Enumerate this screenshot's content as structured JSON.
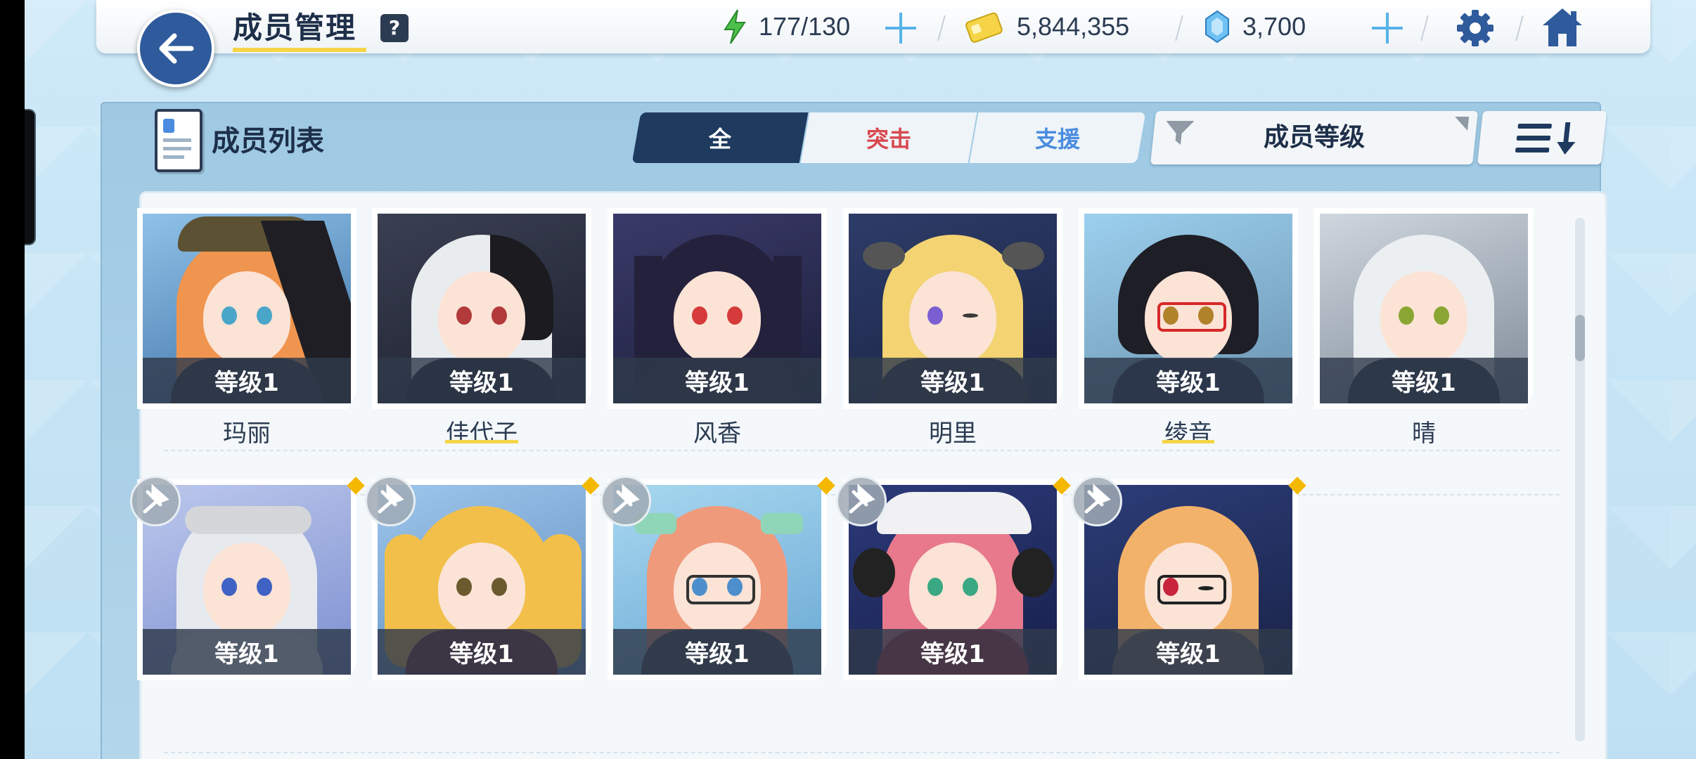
{
  "header": {
    "title": "成员管理",
    "help": "?",
    "stamina": "177/130",
    "credits": "5,844,355",
    "gems": "3,700"
  },
  "panel": {
    "title": "成员列表",
    "tabs": [
      {
        "label": "全",
        "active": true
      },
      {
        "label": "突击",
        "active": false
      },
      {
        "label": "支援",
        "active": false
      }
    ],
    "sort_label": "成员等级"
  },
  "members": [
    {
      "level": "等级1",
      "name": "玛丽"
    },
    {
      "level": "等级1",
      "name": "佳代子"
    },
    {
      "level": "等级1",
      "name": "风香"
    },
    {
      "level": "等级1",
      "name": "明里"
    },
    {
      "level": "等级1",
      "name": "绫音"
    },
    {
      "level": "等级1",
      "name": "晴"
    },
    {
      "level": "等级1",
      "name": ""
    },
    {
      "level": "等级1",
      "name": ""
    },
    {
      "level": "等级1",
      "name": ""
    },
    {
      "level": "等级1",
      "name": ""
    },
    {
      "level": "等级1",
      "name": ""
    }
  ],
  "colors": {
    "accent": "#1f3a5f",
    "assault": "#d8484f",
    "support": "#4a8ce0",
    "highlight": "#f5d547",
    "new_badge": "#f5b800"
  }
}
